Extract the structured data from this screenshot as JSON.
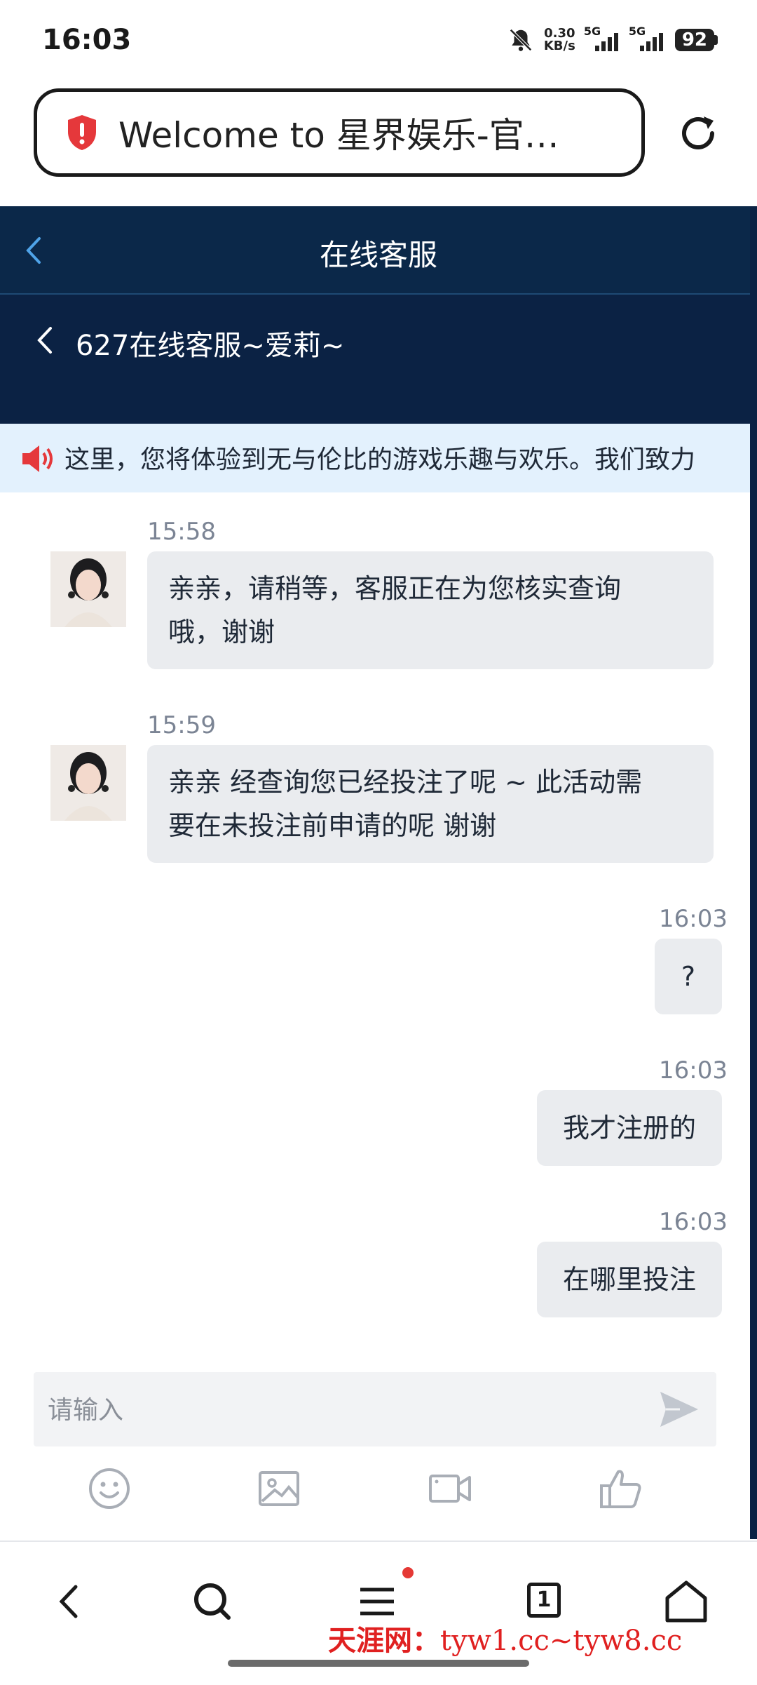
{
  "status": {
    "time": "16:03",
    "speed_value": "0.30",
    "speed_unit": "KB/s",
    "sig1": "5G",
    "sig2": "5G",
    "battery": "92"
  },
  "browser": {
    "page_title": "Welcome to 星界娱乐-官方…"
  },
  "chat": {
    "header_title": "在线客服",
    "agent_name": "627在线客服~爱莉~",
    "marquee": "这里，您将体验到无与伦比的游戏乐趣与欢乐。我们致力",
    "messages": [
      {
        "side": "left",
        "time": "15:58",
        "line1": "亲亲，请稍等，客服正在为您核实查询",
        "line2": "哦，谢谢"
      },
      {
        "side": "left",
        "time": "15:59",
        "line1": "亲亲 经查询您已经投注了呢 ~ 此活动需",
        "line2": "要在未投注前申请的呢 谢谢"
      },
      {
        "side": "right",
        "time": "16:03",
        "text": "?"
      },
      {
        "side": "right",
        "time": "16:03",
        "text": "我才注册的"
      },
      {
        "side": "right",
        "time": "16:03",
        "text": "在哪里投注"
      }
    ],
    "input_placeholder": "请输入"
  },
  "nav": {
    "tab_count": "1"
  },
  "watermark": {
    "cn": "天涯网：",
    "urls": "tyw1.cc~tyw8.cc"
  },
  "colors": {
    "header_bg": "#0b2849",
    "marquee_bg": "#e3f1fd",
    "bubble_bg": "#eaecef",
    "time_color": "#7b8494"
  },
  "icons": [
    "silent-bell-icon",
    "shield-icon",
    "reload-icon",
    "back-icon",
    "speaker-icon",
    "send-icon",
    "emoji-icon",
    "image-icon",
    "video-icon",
    "thumbs-up-icon",
    "search-icon",
    "menu-icon",
    "home-icon"
  ]
}
